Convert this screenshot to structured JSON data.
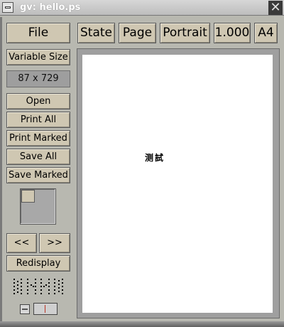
{
  "window": {
    "title": "gv: hello.ps"
  },
  "toolbar": {
    "file_label": "File",
    "state_label": "State",
    "page_label": "Page",
    "orientation_label": "Portrait",
    "scale_label": "1.000",
    "media_label": "A4"
  },
  "sidebar": {
    "size_mode_label": "Variable Size",
    "size_display": "87 x 729",
    "open_label": "Open",
    "print_all_label": "Print All",
    "print_marked_label": "Print Marked",
    "save_all_label": "Save All",
    "save_marked_label": "Save Marked",
    "prev_label": "<<",
    "next_label": ">>",
    "redisplay_label": "Redisplay"
  },
  "document": {
    "text": "测試"
  },
  "icons": {
    "orientation_icons": [
      "orientation-portrait-icon",
      "orientation-landscape-icon",
      "orientation-upside-down-icon",
      "orientation-seascape-icon"
    ]
  }
}
